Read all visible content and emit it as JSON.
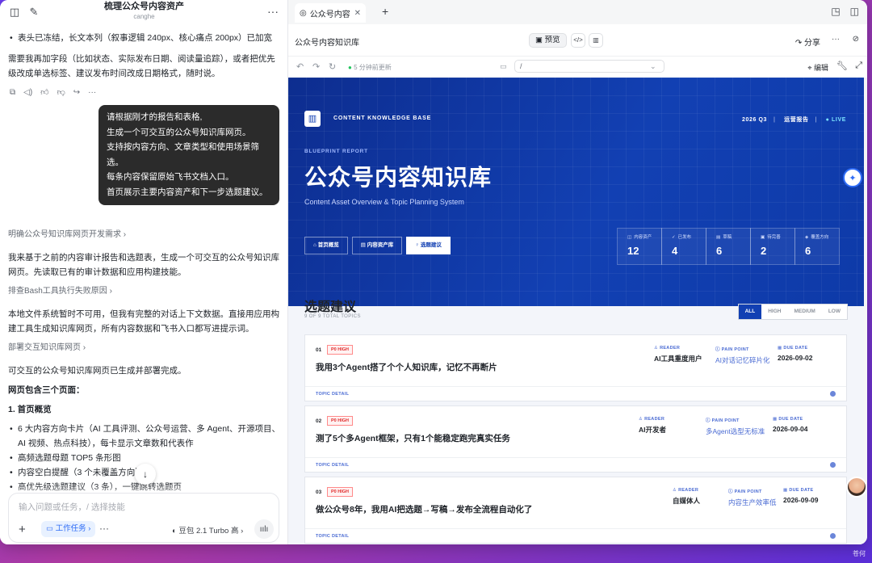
{
  "chat": {
    "title": "梳理公众号内容资产",
    "subtitle": "canghe",
    "top_bullet": "表头已冻结，长文本列（叙事逻辑 240px、核心痛点 200px）已加宽",
    "para1": "需要我再加字段（比如状态、实际发布日期、阅读量追踪），或者把优先级改成单选标签、建议发布时间改成日期格式，随时说。",
    "user_msg": [
      "请根据刚才的报告和表格,",
      "生成一个可交互的公众号知识库网页。",
      "支持按内容方向、文章类型和使用场景筛选。",
      "每条内容保留原始飞书文档入口。",
      "首页展示主要内容资产和下一步选题建议。"
    ],
    "step1": "明确公众号知识库网页开发需求 ›",
    "para2": "我来基于之前的内容审计报告和选题表，生成一个可交互的公众号知识库网页。先读取已有的审计数据和应用构建技能。",
    "step2": "排查Bash工具执行失败原因 ›",
    "para3": "本地文件系统暂时不可用，但我有完整的对话上下文数据。直接用应用构建工具生成知识库网页，所有内容数据和飞书入口都写进提示词。",
    "step3": "部署交互知识库网页 ›",
    "para4": "可交互的公众号知识库网页已生成并部署完成。",
    "para5": "网页包含三个页面：",
    "para6": "1. 首页概览",
    "bullets": [
      "6 大内容方向卡片（AI 工具评测、公众号运营、多 Agent、开源项目、AI 视频、热点科技），每卡显示文章数和代表作",
      "高频选题母题 TOP5 条形图",
      "内容空白提醒（3 个未覆盖方向）",
      "高优先级选题建议（3 条），一键跳转选题页"
    ],
    "composer_placeholder": "输入问题或任务，/ 选择技能",
    "task_label": "工作任务 ›",
    "model_label": "豆包 2.1 Turbo 高 ›"
  },
  "browser": {
    "tab_label": "公众号内容",
    "page_name": "公众号内容知识库",
    "preview": "预览",
    "share": "分享",
    "updated": "5 分钟前更新",
    "url": "/",
    "edit": "编辑"
  },
  "site": {
    "brand": "CONTENT KNOWLEDGE BASE",
    "period": "2026 Q3",
    "report": "运营报告",
    "live": "● LIVE",
    "kicker": "BLUEPRINT REPORT",
    "title": "公众号内容知识库",
    "subtitle": "Content Asset Overview & Topic Planning System",
    "tabs": [
      "首页概览",
      "内容资产库",
      "选题建议"
    ],
    "stats": [
      {
        "label": "内容资产",
        "icon": "database-icon",
        "value": "12"
      },
      {
        "label": "已发布",
        "icon": "check-icon",
        "value": "4"
      },
      {
        "label": "草稿",
        "icon": "doc-icon",
        "value": "6"
      },
      {
        "label": "待完善",
        "icon": "clipboard-icon",
        "value": "2"
      },
      {
        "label": "覆盖方向",
        "icon": "layers-icon",
        "value": "6"
      }
    ],
    "section_title": "选题建议",
    "section_sub": "9 OF 9 TOTAL TOPICS",
    "filters": [
      "ALL",
      "HIGH",
      "MEDIUM",
      "LOW"
    ],
    "labels": {
      "reader": "READER",
      "pain": "PAIN POINT",
      "due": "DUE DATE",
      "detail": "TOPIC DETAIL"
    },
    "topics": [
      {
        "no": "01",
        "priority": "P0 HIGH",
        "title": "我用3个Agent搭了个个人知识库，记忆不再断片",
        "reader": "AI工具重度用户",
        "pain": "AI对话记忆碎片化",
        "due": "2026-09-02"
      },
      {
        "no": "02",
        "priority": "P0 HIGH",
        "title": "测了5个多Agent框架，只有1个能稳定跑完真实任务",
        "reader": "AI开发者",
        "pain": "多Agent选型无标准",
        "due": "2026-09-04"
      },
      {
        "no": "03",
        "priority": "P0 HIGH",
        "title": "做公众号8年，我用AI把选题→写稿→发布全流程自动化了",
        "reader": "自媒体人",
        "pain": "内容生产效率低",
        "due": "2026-09-09"
      }
    ]
  },
  "watermark": "苍何"
}
